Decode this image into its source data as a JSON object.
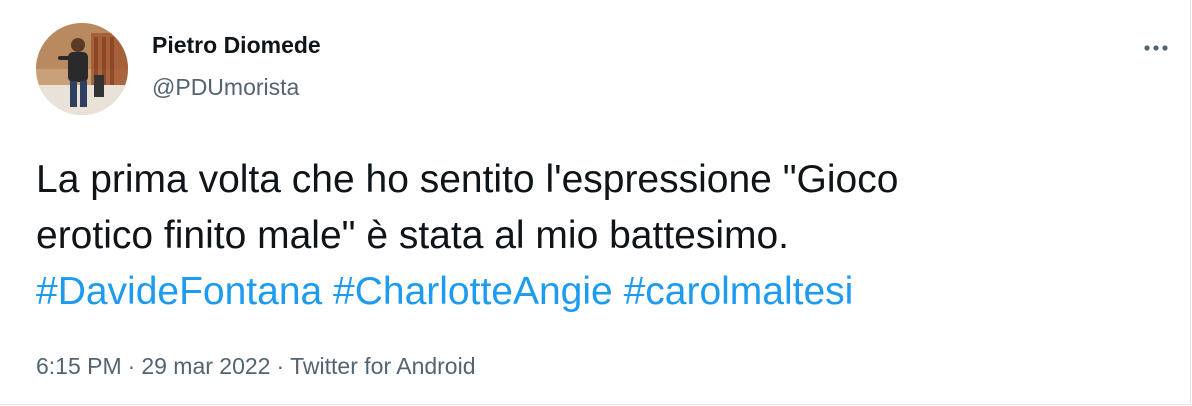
{
  "author": {
    "display_name": "Pietro Diomede",
    "handle": "@PDUmorista",
    "avatar_icon": "profile-photo"
  },
  "more_icon": "more-horizontal-icon",
  "tweet": {
    "line1": "La prima volta che ho sentito l'espressione \"Gioco",
    "line2": "erotico finito male\" è stata al mio battesimo.",
    "hashtags": [
      "#DavideFontana",
      "#CharlotteAngie",
      "#carolmaltesi"
    ]
  },
  "meta": {
    "time": "6:15 PM",
    "separator": "·",
    "date": "29 mar 2022",
    "source": "Twitter for Android"
  },
  "colors": {
    "text": "#0f1419",
    "secondary": "#536471",
    "link": "#1d9bf0"
  }
}
